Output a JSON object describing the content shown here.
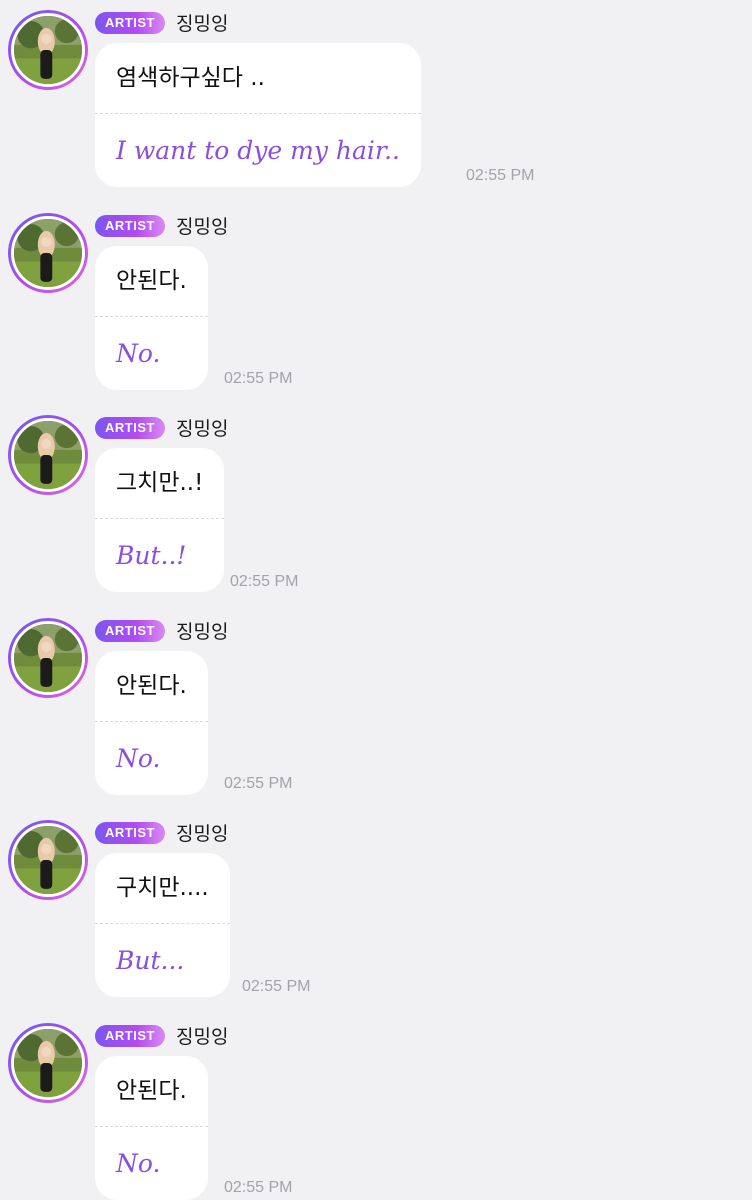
{
  "colors": {
    "background": "#f1f1f3",
    "bubble": "#ffffff",
    "translation_text": "#8a4fe0",
    "badge_gradient_start": "#7b55f0",
    "badge_gradient_end": "#d98af2",
    "avatar_ring": "#b04cf0",
    "timestamp": "#a3a3a8"
  },
  "messages": [
    {
      "badge": "ARTIST",
      "sender": "징밍잉",
      "text": "염색하구싶다 ..",
      "translation": "I want to dye my hair..",
      "time": "02:55 PM",
      "avatar_icon": "profile-photo"
    },
    {
      "badge": "ARTIST",
      "sender": "징밍잉",
      "text": "안된다.",
      "translation": "No.",
      "time": "02:55 PM",
      "avatar_icon": "profile-photo"
    },
    {
      "badge": "ARTIST",
      "sender": "징밍잉",
      "text": "그치만..!",
      "translation": "But..!",
      "time": "02:55 PM",
      "avatar_icon": "profile-photo"
    },
    {
      "badge": "ARTIST",
      "sender": "징밍잉",
      "text": "안된다.",
      "translation": "No.",
      "time": "02:55 PM",
      "avatar_icon": "profile-photo"
    },
    {
      "badge": "ARTIST",
      "sender": "징밍잉",
      "text": "구치만....",
      "translation": "But...",
      "time": "02:55 PM",
      "avatar_icon": "profile-photo"
    },
    {
      "badge": "ARTIST",
      "sender": "징밍잉",
      "text": "안된다.",
      "translation": "No.",
      "time": "02:55 PM",
      "avatar_icon": "profile-photo"
    }
  ]
}
